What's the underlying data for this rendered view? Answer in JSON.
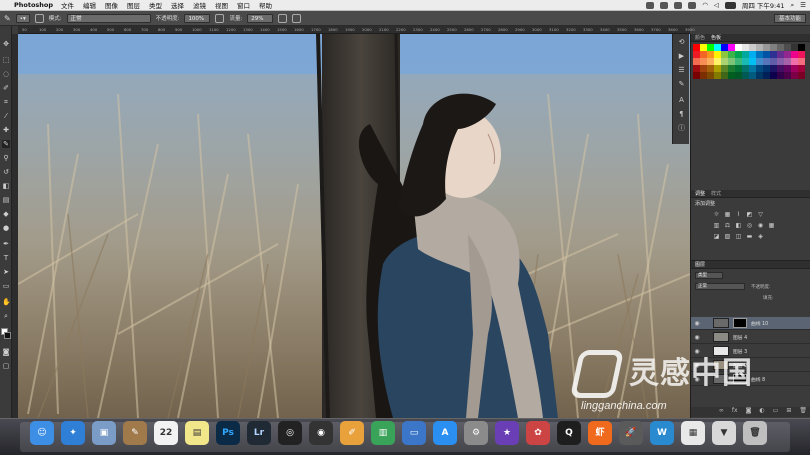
{
  "menubar": {
    "app_name": "Photoshop",
    "items": [
      "文件",
      "编辑",
      "图像",
      "图层",
      "类型",
      "选择",
      "滤镜",
      "视图",
      "窗口",
      "帮助"
    ],
    "clock": "周四 下午9:41"
  },
  "options_bar": {
    "mode_label": "模式:",
    "mode_value": "正常",
    "opacity_label": "不透明度:",
    "opacity_value": "100%",
    "flow_label": "流量:",
    "flow_value": "29%",
    "workspace": "基本功能"
  },
  "ruler": {
    "marks": [
      "50",
      "100",
      "200",
      "300",
      "400",
      "500",
      "600",
      "700",
      "800",
      "900",
      "1000",
      "1100",
      "1200",
      "1300",
      "1400",
      "1500",
      "1600",
      "1700",
      "1800",
      "1900",
      "2000",
      "2100",
      "2200",
      "2300",
      "2400",
      "2500",
      "2600",
      "2700",
      "2800",
      "2900",
      "3000",
      "3100",
      "3200",
      "3300",
      "3400",
      "3500",
      "3600",
      "3700",
      "3800",
      "3900"
    ]
  },
  "swatches_panel": {
    "tabs": [
      "颜色",
      "色板"
    ],
    "active_tab": "色板"
  },
  "adjustments_panel": {
    "tabs": [
      "调整",
      "样式"
    ],
    "title": "添加调整"
  },
  "layers_panel": {
    "tab": "图层",
    "kind_label": "类型",
    "blend_mode": "正常",
    "opacity_label": "不透明度:",
    "fill_label": "填充:",
    "layers": [
      {
        "name": "曲线 10",
        "selected": true,
        "type": "adjustment"
      },
      {
        "name": "图层 4",
        "selected": false,
        "type": "pixel"
      },
      {
        "name": "图层 3",
        "selected": false,
        "type": "pixel"
      },
      {
        "name": "图层 2",
        "selected": false,
        "type": "pixel"
      },
      {
        "name": "曲线 8",
        "selected": false,
        "type": "adjustment"
      }
    ]
  },
  "watermark": {
    "title": "灵感中国",
    "url": "lingganchina.com"
  },
  "dock": {
    "apps": [
      {
        "name": "finder",
        "glyph": "☺",
        "color": "#3d8fe6"
      },
      {
        "name": "safari",
        "glyph": "✦",
        "color": "#2f7fd6"
      },
      {
        "name": "preview",
        "glyph": "▣",
        "color": "#7a9cc6"
      },
      {
        "name": "notes",
        "glyph": "✎",
        "color": "#a07a4a"
      },
      {
        "name": "calendar",
        "glyph": "22",
        "color": "#f2f2f2"
      },
      {
        "name": "stickies",
        "glyph": "▤",
        "color": "#f2e68a"
      },
      {
        "name": "photoshop",
        "glyph": "Ps",
        "color": "#0a2a46"
      },
      {
        "name": "lightroom",
        "glyph": "Lr",
        "color": "#1f2a34"
      },
      {
        "name": "aperture",
        "glyph": "◎",
        "color": "#222"
      },
      {
        "name": "camera",
        "glyph": "◉",
        "color": "#333"
      },
      {
        "name": "pages",
        "glyph": "✐",
        "color": "#e9a23b"
      },
      {
        "name": "numbers",
        "glyph": "▥",
        "color": "#3aa35a"
      },
      {
        "name": "keynote",
        "glyph": "▭",
        "color": "#3b76c8"
      },
      {
        "name": "appstore",
        "glyph": "A",
        "color": "#2a8ff0"
      },
      {
        "name": "system-preferences",
        "glyph": "⚙",
        "color": "#8b8b8b"
      },
      {
        "name": "imovie",
        "glyph": "★",
        "color": "#6a3fb5"
      },
      {
        "name": "photos",
        "glyph": "✿",
        "color": "#c44"
      },
      {
        "name": "qq",
        "glyph": "Q",
        "color": "#1e1e1e"
      },
      {
        "name": "xiami",
        "glyph": "虾",
        "color": "#f06a1e"
      },
      {
        "name": "launchpad",
        "glyph": "🚀",
        "color": "#5a5a5a"
      },
      {
        "name": "app-w",
        "glyph": "W",
        "color": "#2a8ad0"
      },
      {
        "name": "finder-folder",
        "glyph": "▦",
        "color": "#e8e8e8"
      },
      {
        "name": "downloads",
        "glyph": "▼",
        "color": "#d8d8d8"
      },
      {
        "name": "trash",
        "glyph": "🗑",
        "color": "#bfbfbf"
      }
    ]
  }
}
